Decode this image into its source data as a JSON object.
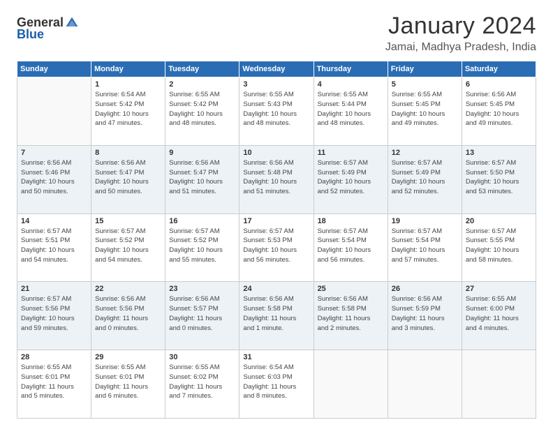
{
  "logo": {
    "general": "General",
    "blue": "Blue"
  },
  "header": {
    "title": "January 2024",
    "subtitle": "Jamai, Madhya Pradesh, India"
  },
  "weekdays": [
    "Sunday",
    "Monday",
    "Tuesday",
    "Wednesday",
    "Thursday",
    "Friday",
    "Saturday"
  ],
  "weeks": [
    [
      {
        "day": "",
        "info": ""
      },
      {
        "day": "1",
        "info": "Sunrise: 6:54 AM\nSunset: 5:42 PM\nDaylight: 10 hours\nand 47 minutes."
      },
      {
        "day": "2",
        "info": "Sunrise: 6:55 AM\nSunset: 5:42 PM\nDaylight: 10 hours\nand 48 minutes."
      },
      {
        "day": "3",
        "info": "Sunrise: 6:55 AM\nSunset: 5:43 PM\nDaylight: 10 hours\nand 48 minutes."
      },
      {
        "day": "4",
        "info": "Sunrise: 6:55 AM\nSunset: 5:44 PM\nDaylight: 10 hours\nand 48 minutes."
      },
      {
        "day": "5",
        "info": "Sunrise: 6:55 AM\nSunset: 5:45 PM\nDaylight: 10 hours\nand 49 minutes."
      },
      {
        "day": "6",
        "info": "Sunrise: 6:56 AM\nSunset: 5:45 PM\nDaylight: 10 hours\nand 49 minutes."
      }
    ],
    [
      {
        "day": "7",
        "info": "Sunrise: 6:56 AM\nSunset: 5:46 PM\nDaylight: 10 hours\nand 50 minutes."
      },
      {
        "day": "8",
        "info": "Sunrise: 6:56 AM\nSunset: 5:47 PM\nDaylight: 10 hours\nand 50 minutes."
      },
      {
        "day": "9",
        "info": "Sunrise: 6:56 AM\nSunset: 5:47 PM\nDaylight: 10 hours\nand 51 minutes."
      },
      {
        "day": "10",
        "info": "Sunrise: 6:56 AM\nSunset: 5:48 PM\nDaylight: 10 hours\nand 51 minutes."
      },
      {
        "day": "11",
        "info": "Sunrise: 6:57 AM\nSunset: 5:49 PM\nDaylight: 10 hours\nand 52 minutes."
      },
      {
        "day": "12",
        "info": "Sunrise: 6:57 AM\nSunset: 5:49 PM\nDaylight: 10 hours\nand 52 minutes."
      },
      {
        "day": "13",
        "info": "Sunrise: 6:57 AM\nSunset: 5:50 PM\nDaylight: 10 hours\nand 53 minutes."
      }
    ],
    [
      {
        "day": "14",
        "info": "Sunrise: 6:57 AM\nSunset: 5:51 PM\nDaylight: 10 hours\nand 54 minutes."
      },
      {
        "day": "15",
        "info": "Sunrise: 6:57 AM\nSunset: 5:52 PM\nDaylight: 10 hours\nand 54 minutes."
      },
      {
        "day": "16",
        "info": "Sunrise: 6:57 AM\nSunset: 5:52 PM\nDaylight: 10 hours\nand 55 minutes."
      },
      {
        "day": "17",
        "info": "Sunrise: 6:57 AM\nSunset: 5:53 PM\nDaylight: 10 hours\nand 56 minutes."
      },
      {
        "day": "18",
        "info": "Sunrise: 6:57 AM\nSunset: 5:54 PM\nDaylight: 10 hours\nand 56 minutes."
      },
      {
        "day": "19",
        "info": "Sunrise: 6:57 AM\nSunset: 5:54 PM\nDaylight: 10 hours\nand 57 minutes."
      },
      {
        "day": "20",
        "info": "Sunrise: 6:57 AM\nSunset: 5:55 PM\nDaylight: 10 hours\nand 58 minutes."
      }
    ],
    [
      {
        "day": "21",
        "info": "Sunrise: 6:57 AM\nSunset: 5:56 PM\nDaylight: 10 hours\nand 59 minutes."
      },
      {
        "day": "22",
        "info": "Sunrise: 6:56 AM\nSunset: 5:56 PM\nDaylight: 11 hours\nand 0 minutes."
      },
      {
        "day": "23",
        "info": "Sunrise: 6:56 AM\nSunset: 5:57 PM\nDaylight: 11 hours\nand 0 minutes."
      },
      {
        "day": "24",
        "info": "Sunrise: 6:56 AM\nSunset: 5:58 PM\nDaylight: 11 hours\nand 1 minute."
      },
      {
        "day": "25",
        "info": "Sunrise: 6:56 AM\nSunset: 5:58 PM\nDaylight: 11 hours\nand 2 minutes."
      },
      {
        "day": "26",
        "info": "Sunrise: 6:56 AM\nSunset: 5:59 PM\nDaylight: 11 hours\nand 3 minutes."
      },
      {
        "day": "27",
        "info": "Sunrise: 6:55 AM\nSunset: 6:00 PM\nDaylight: 11 hours\nand 4 minutes."
      }
    ],
    [
      {
        "day": "28",
        "info": "Sunrise: 6:55 AM\nSunset: 6:01 PM\nDaylight: 11 hours\nand 5 minutes."
      },
      {
        "day": "29",
        "info": "Sunrise: 6:55 AM\nSunset: 6:01 PM\nDaylight: 11 hours\nand 6 minutes."
      },
      {
        "day": "30",
        "info": "Sunrise: 6:55 AM\nSunset: 6:02 PM\nDaylight: 11 hours\nand 7 minutes."
      },
      {
        "day": "31",
        "info": "Sunrise: 6:54 AM\nSunset: 6:03 PM\nDaylight: 11 hours\nand 8 minutes."
      },
      {
        "day": "",
        "info": ""
      },
      {
        "day": "",
        "info": ""
      },
      {
        "day": "",
        "info": ""
      }
    ]
  ],
  "row_colors": [
    "#ffffff",
    "#edf2f7",
    "#ffffff",
    "#edf2f7",
    "#ffffff"
  ]
}
